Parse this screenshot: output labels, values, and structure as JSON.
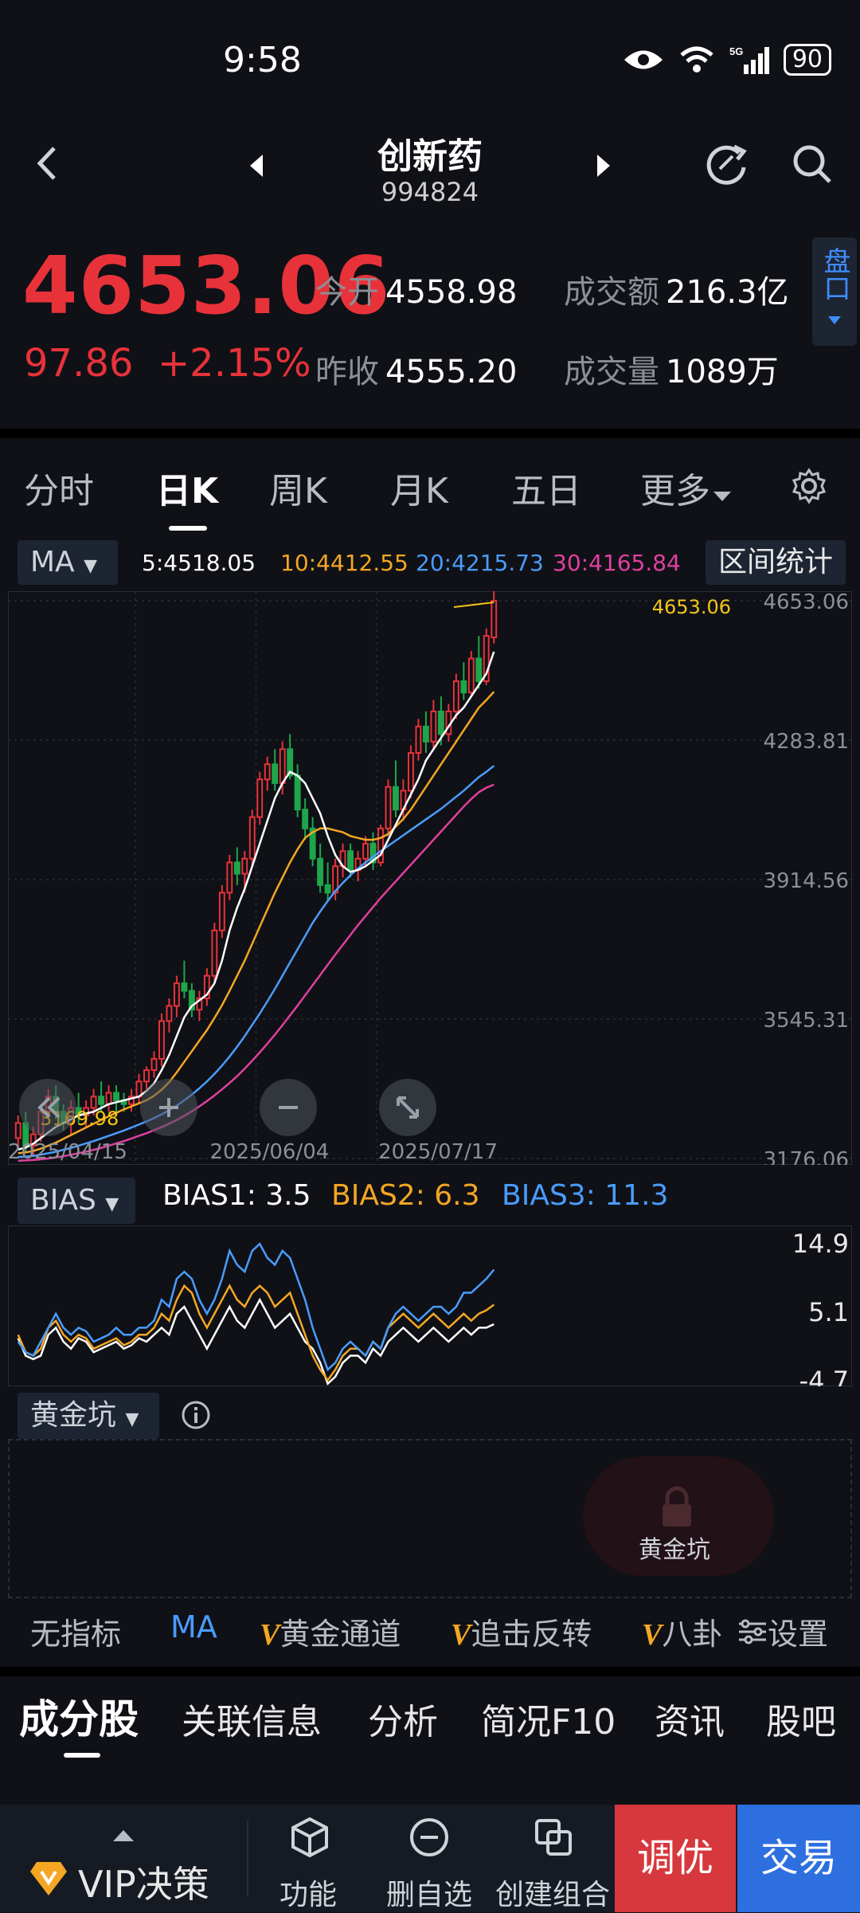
{
  "status_bar": {
    "time": "9:58",
    "battery": "90",
    "network": "5G"
  },
  "header": {
    "title": "创新药",
    "code": "994824"
  },
  "quote": {
    "price": "4653.06",
    "change": "97.86",
    "change_pct": "+2.15%",
    "open_label": "今开",
    "open": "4558.98",
    "prev_close_label": "昨收",
    "prev_close": "4555.20",
    "turnover_label": "成交额",
    "turnover": "216.3亿",
    "volume_label": "成交量",
    "volume": "1089万",
    "pankou_label": "盘口"
  },
  "period_tabs": [
    "分时",
    "日K",
    "周K",
    "月K",
    "五日",
    "更多"
  ],
  "active_tab": "日K",
  "ma_bar": {
    "selector": "MA",
    "ma5": "5:4518.05",
    "ma10": "10:4412.55",
    "ma20": "20:4215.73",
    "ma30": "30:4165.84",
    "range_stats": "区间统计"
  },
  "colors": {
    "up": "#e8323a",
    "down": "#1fa64a",
    "ma5": "#ffffff",
    "ma10": "#f5a623",
    "ma20": "#4a9cff",
    "ma30": "#e040a0",
    "accent_blue": "#3f8cff"
  },
  "chart_data": [
    {
      "type": "candlestick",
      "y_ticks": [
        "4653.06",
        "4283.81",
        "3914.56",
        "3545.31",
        "3176.06"
      ],
      "ylim": [
        3176.06,
        4653.06
      ],
      "x_labels": [
        "2025/04/15",
        "2025/06/04",
        "2025/07/17"
      ],
      "max_label": "4653.06",
      "min_label": "3169.98",
      "ohlc": [
        [
          3230,
          3290,
          3200,
          3270
        ],
        [
          3270,
          3300,
          3190,
          3210
        ],
        [
          3210,
          3260,
          3180,
          3240
        ],
        [
          3240,
          3320,
          3220,
          3300
        ],
        [
          3300,
          3360,
          3280,
          3340
        ],
        [
          3340,
          3370,
          3280,
          3300
        ],
        [
          3300,
          3320,
          3250,
          3270
        ],
        [
          3270,
          3330,
          3240,
          3310
        ],
        [
          3310,
          3350,
          3270,
          3290
        ],
        [
          3290,
          3330,
          3260,
          3310
        ],
        [
          3310,
          3360,
          3290,
          3340
        ],
        [
          3340,
          3380,
          3300,
          3320
        ],
        [
          3320,
          3370,
          3300,
          3350
        ],
        [
          3350,
          3370,
          3300,
          3330
        ],
        [
          3330,
          3350,
          3300,
          3320
        ],
        [
          3320,
          3360,
          3300,
          3340
        ],
        [
          3340,
          3400,
          3320,
          3380
        ],
        [
          3380,
          3420,
          3360,
          3410
        ],
        [
          3410,
          3460,
          3390,
          3440
        ],
        [
          3440,
          3560,
          3420,
          3540
        ],
        [
          3540,
          3600,
          3510,
          3580
        ],
        [
          3580,
          3660,
          3550,
          3640
        ],
        [
          3640,
          3700,
          3600,
          3620
        ],
        [
          3620,
          3640,
          3550,
          3570
        ],
        [
          3570,
          3620,
          3540,
          3600
        ],
        [
          3600,
          3680,
          3580,
          3660
        ],
        [
          3660,
          3800,
          3640,
          3780
        ],
        [
          3780,
          3900,
          3760,
          3880
        ],
        [
          3880,
          3980,
          3860,
          3960
        ],
        [
          3960,
          4000,
          3900,
          3930
        ],
        [
          3930,
          3990,
          3880,
          3970
        ],
        [
          3970,
          4100,
          3950,
          4080
        ],
        [
          4080,
          4200,
          4060,
          4180
        ],
        [
          4180,
          4240,
          4150,
          4220
        ],
        [
          4220,
          4260,
          4150,
          4170
        ],
        [
          4170,
          4280,
          4140,
          4260
        ],
        [
          4260,
          4300,
          4180,
          4190
        ],
        [
          4190,
          4220,
          4080,
          4100
        ],
        [
          4100,
          4130,
          4020,
          4050
        ],
        [
          4050,
          4080,
          3950,
          3970
        ],
        [
          3970,
          4010,
          3880,
          3900
        ],
        [
          3900,
          3960,
          3860,
          3880
        ],
        [
          3880,
          3970,
          3860,
          3950
        ],
        [
          3950,
          4010,
          3920,
          3990
        ],
        [
          3990,
          4010,
          3920,
          3940
        ],
        [
          3940,
          3990,
          3910,
          3970
        ],
        [
          3970,
          4030,
          3950,
          4010
        ],
        [
          4010,
          4040,
          3940,
          3960
        ],
        [
          3960,
          4060,
          3950,
          4050
        ],
        [
          4050,
          4180,
          4030,
          4160
        ],
        [
          4160,
          4230,
          4080,
          4100
        ],
        [
          4100,
          4180,
          4070,
          4150
        ],
        [
          4150,
          4270,
          4130,
          4250
        ],
        [
          4250,
          4340,
          4230,
          4320
        ],
        [
          4320,
          4360,
          4250,
          4280
        ],
        [
          4280,
          4390,
          4260,
          4360
        ],
        [
          4360,
          4400,
          4270,
          4300
        ],
        [
          4300,
          4380,
          4280,
          4360
        ],
        [
          4360,
          4460,
          4340,
          4440
        ],
        [
          4440,
          4490,
          4390,
          4410
        ],
        [
          4410,
          4520,
          4400,
          4500
        ],
        [
          4500,
          4560,
          4420,
          4440
        ],
        [
          4440,
          4580,
          4430,
          4560
        ],
        [
          4556,
          4680,
          4540,
          4653
        ]
      ],
      "ma5": [
        3200,
        3205,
        3215,
        3230,
        3245,
        3260,
        3270,
        3280,
        3290,
        3295,
        3300,
        3310,
        3320,
        3325,
        3330,
        3335,
        3340,
        3355,
        3375,
        3410,
        3450,
        3500,
        3550,
        3580,
        3595,
        3610,
        3640,
        3700,
        3780,
        3840,
        3890,
        3950,
        4010,
        4070,
        4130,
        4170,
        4200,
        4190,
        4170,
        4130,
        4090,
        4030,
        3980,
        3950,
        3935,
        3940,
        3950,
        3965,
        3980,
        4020,
        4060,
        4100,
        4140,
        4180,
        4230,
        4260,
        4290,
        4320,
        4350,
        4370,
        4400,
        4430,
        4460,
        4518
      ],
      "ma10": [
        3190,
        3192,
        3196,
        3202,
        3210,
        3218,
        3228,
        3238,
        3248,
        3258,
        3268,
        3278,
        3288,
        3297,
        3306,
        3314,
        3322,
        3330,
        3342,
        3358,
        3378,
        3404,
        3432,
        3460,
        3488,
        3516,
        3548,
        3582,
        3620,
        3660,
        3700,
        3745,
        3790,
        3835,
        3880,
        3920,
        3960,
        3995,
        4025,
        4040,
        4050,
        4050,
        4045,
        4040,
        4030,
        4025,
        4020,
        4020,
        4025,
        4035,
        4055,
        4075,
        4100,
        4130,
        4160,
        4190,
        4220,
        4250,
        4280,
        4310,
        4340,
        4370,
        4390,
        4412
      ],
      "ma20": [
        3180,
        3181,
        3183,
        3186,
        3190,
        3194,
        3199,
        3204,
        3210,
        3216,
        3222,
        3229,
        3236,
        3243,
        3250,
        3258,
        3266,
        3274,
        3283,
        3293,
        3304,
        3316,
        3330,
        3345,
        3362,
        3380,
        3400,
        3422,
        3446,
        3472,
        3500,
        3530,
        3560,
        3592,
        3625,
        3660,
        3695,
        3730,
        3765,
        3800,
        3830,
        3858,
        3884,
        3906,
        3926,
        3944,
        3960,
        3975,
        3990,
        4004,
        4018,
        4032,
        4046,
        4060,
        4074,
        4088,
        4102,
        4118,
        4134,
        4150,
        4168,
        4186,
        4200,
        4216
      ],
      "ma30": [
        3170,
        3171,
        3172,
        3174,
        3176,
        3179,
        3182,
        3186,
        3190,
        3194,
        3199,
        3204,
        3210,
        3216,
        3222,
        3229,
        3236,
        3243,
        3251,
        3259,
        3268,
        3278,
        3289,
        3301,
        3314,
        3328,
        3343,
        3359,
        3376,
        3394,
        3414,
        3435,
        3457,
        3480,
        3504,
        3529,
        3555,
        3581,
        3608,
        3635,
        3662,
        3689,
        3716,
        3742,
        3768,
        3794,
        3818,
        3842,
        3866,
        3888,
        3910,
        3932,
        3954,
        3976,
        3998,
        4020,
        4042,
        4064,
        4086,
        4108,
        4128,
        4146,
        4158,
        4166
      ]
    },
    {
      "type": "line",
      "title": "BIAS",
      "y_ticks": [
        "14.9",
        "5.1",
        "-4.7"
      ],
      "ylim": [
        -4.7,
        14.9
      ],
      "series": [
        {
          "name": "BIAS1",
          "values": [
            1.5,
            -1,
            -1.5,
            -1,
            2,
            3,
            1,
            0,
            1.5,
            1,
            -0.5,
            0,
            0.5,
            1,
            0,
            0.5,
            1.5,
            1,
            2,
            3,
            2,
            5,
            6,
            4,
            2,
            0,
            2,
            4,
            6,
            4,
            3,
            5,
            7,
            5,
            3,
            4,
            5,
            3,
            1,
            0,
            -2,
            -5,
            -4,
            -2,
            -1,
            -1,
            -2,
            0,
            -1,
            1,
            2,
            3,
            2,
            1,
            2,
            3,
            2,
            1,
            2,
            3,
            2,
            3,
            3,
            3.5
          ]
        },
        {
          "name": "BIAS2",
          "values": [
            2,
            -0.5,
            -1,
            0,
            3,
            4,
            2,
            1,
            2,
            1.5,
            0,
            0.5,
            1,
            1.5,
            0.5,
            1,
            2,
            2,
            3,
            5,
            4,
            7,
            9,
            8,
            5,
            3,
            5,
            7,
            9,
            7,
            6,
            8,
            9,
            8,
            6,
            7,
            8,
            5,
            2,
            -1,
            -3,
            -4.5,
            -3,
            -1,
            0,
            0,
            -1,
            1,
            0,
            3,
            4,
            5,
            4,
            3,
            4,
            5,
            4,
            3,
            4,
            5,
            4,
            5,
            5.5,
            6.3
          ]
        },
        {
          "name": "BIAS3",
          "values": [
            1,
            -0.5,
            -1,
            1,
            3,
            5,
            3,
            2,
            3,
            2.5,
            1,
            1.5,
            2,
            3,
            2,
            2,
            3,
            3,
            4,
            7,
            6,
            10,
            11,
            10,
            7,
            5,
            7,
            10,
            14,
            12,
            11,
            14,
            15,
            13,
            12,
            14,
            13,
            10,
            7,
            3,
            0,
            -3,
            -2,
            0,
            1,
            0,
            -1,
            1,
            0,
            3,
            5,
            6,
            5,
            4,
            5,
            6,
            6,
            5,
            6,
            8,
            8,
            9,
            10,
            11.3
          ]
        }
      ]
    }
  ],
  "bias_bar": {
    "selector": "BIAS",
    "b1": "BIAS1: 3.5",
    "b2": "BIAS2: 6.3",
    "b3": "BIAS3: 11.3"
  },
  "hjk": {
    "selector": "黄金坑",
    "locked_label": "黄金坑"
  },
  "indicator_tabs": [
    "无指标",
    "MA",
    "黄金通道",
    "追击反转",
    "八卦"
  ],
  "indicator_settings": "设置",
  "sub_tabs": [
    "成分股",
    "关联信息",
    "分析",
    "简况F10",
    "资讯",
    "股吧"
  ],
  "toolbar": {
    "vip": "VIP决策",
    "func": "功能",
    "del": "删自选",
    "create": "创建组合",
    "optimize": "调优",
    "trade": "交易"
  }
}
